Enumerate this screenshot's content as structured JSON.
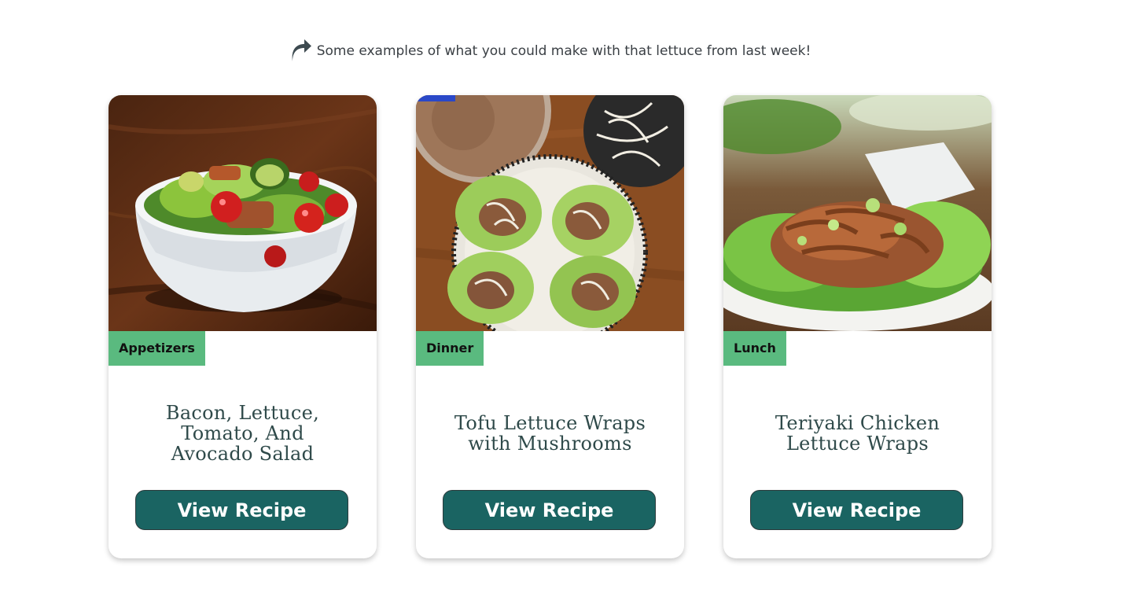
{
  "intro": {
    "icon": "share-arrow-icon",
    "text": "Some examples of what you could make with that lettuce from last week!"
  },
  "colors": {
    "tag": "#5aba7f",
    "button": "#1a6462",
    "title": "#2f4a4a"
  },
  "recipes": [
    {
      "category": "Appetizers",
      "title": "Bacon, Lettuce, Tomato, And Avocado Salad",
      "button_label": "View Recipe",
      "image": "salad-bowl-photo"
    },
    {
      "category": "Dinner",
      "title": "Tofu Lettuce Wraps with Mushrooms",
      "button_label": "View Recipe",
      "image": "tofu-lettuce-wraps-photo"
    },
    {
      "category": "Lunch",
      "title": "Teriyaki Chicken Lettuce Wraps",
      "button_label": "View Recipe",
      "image": "teriyaki-chicken-wraps-photo"
    }
  ]
}
